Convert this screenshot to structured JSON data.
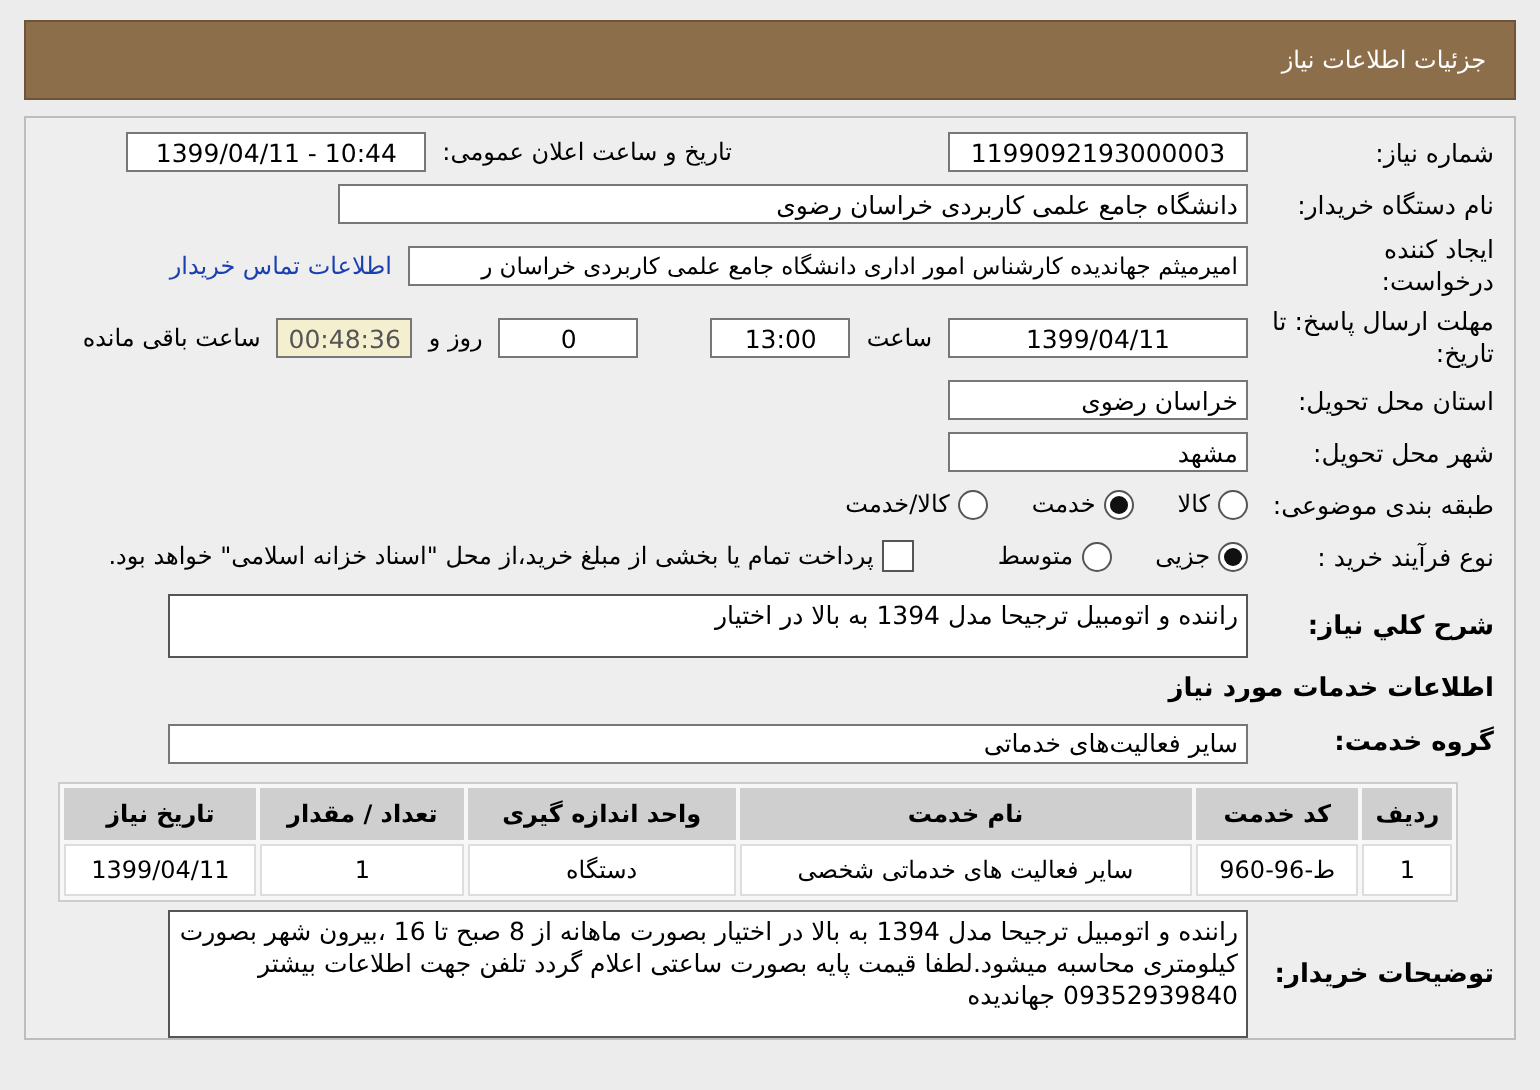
{
  "header": {
    "title": "جزئیات اطلاعات نیاز"
  },
  "need_number": {
    "label": "شماره نیاز:",
    "value": "1199092193000003"
  },
  "announce_date": {
    "label": "تاریخ و ساعت اعلان عمومی:",
    "value": "1399/04/11 - 10:44"
  },
  "buyer_org": {
    "label": "نام دستگاه خریدار:",
    "value": "دانشگاه جامع علمی کاربردی خراسان رضوی"
  },
  "requester": {
    "label": "ایجاد کننده درخواست:",
    "value": "امیرمیثم جهاندیده کارشناس امور اداری دانشگاه جامع علمی کاربردی خراسان ر",
    "link": "اطلاعات تماس خریدار"
  },
  "deadline": {
    "label": "مهلت ارسال پاسخ: تا تاریخ:",
    "date": "1399/04/11",
    "time_label": "ساعت",
    "time": "13:00",
    "days": "0",
    "days_label": "روز و",
    "remaining": "00:48:36",
    "remaining_label": "ساعت باقی مانده"
  },
  "province": {
    "label": "استان محل تحویل:",
    "value": "خراسان رضوی"
  },
  "city": {
    "label": "شهر محل تحویل:",
    "value": "مشهد"
  },
  "category": {
    "label": "طبقه بندی موضوعی:",
    "options": [
      {
        "label": "کالا",
        "selected": false
      },
      {
        "label": "خدمت",
        "selected": true
      },
      {
        "label": "کالا/خدمت",
        "selected": false
      }
    ]
  },
  "process": {
    "label": "نوع فرآیند خرید :",
    "options": [
      {
        "label": "جزیی",
        "selected": true
      },
      {
        "label": "متوسط",
        "selected": false
      }
    ],
    "payment_checkbox": {
      "label": "پرداخت تمام یا بخشی از مبلغ خرید،از محل \"اسناد خزانه اسلامی\" خواهد بود.",
      "checked": false
    }
  },
  "description": {
    "label": "شرح کلي نياز:",
    "value": "راننده و اتومبیل  ترجیحا مدل 1394 به بالا در اختیار"
  },
  "services_heading": "اطلاعات خدمات مورد نیاز",
  "service_group": {
    "label": "گروه خدمت:",
    "value": "سایر فعالیت‌های خدماتی"
  },
  "table": {
    "columns": [
      "ردیف",
      "کد خدمت",
      "نام خدمت",
      "واحد اندازه گیری",
      "تعداد / مقدار",
      "تاریخ نیاز"
    ],
    "rows": [
      [
        "1",
        "ط-96-960",
        "سایر فعالیت های خدماتی شخصی",
        "دستگاه",
        "1",
        "1399/04/11"
      ]
    ]
  },
  "buyer_notes": {
    "label": "توضیحات خریدار:",
    "value": "راننده و اتومبیل  ترجیحا مدل 1394 به بالا در اختیار بصورت  ماهانه از 8 صبح تا 16 ،بیرون شهر بصورت کیلومتری محاسبه میشود.لطفا قیمت پایه بصورت ساعتی اعلام گردد تلفن جهت اطلاعات بیشتر 09352939840 جهاندیده"
  }
}
